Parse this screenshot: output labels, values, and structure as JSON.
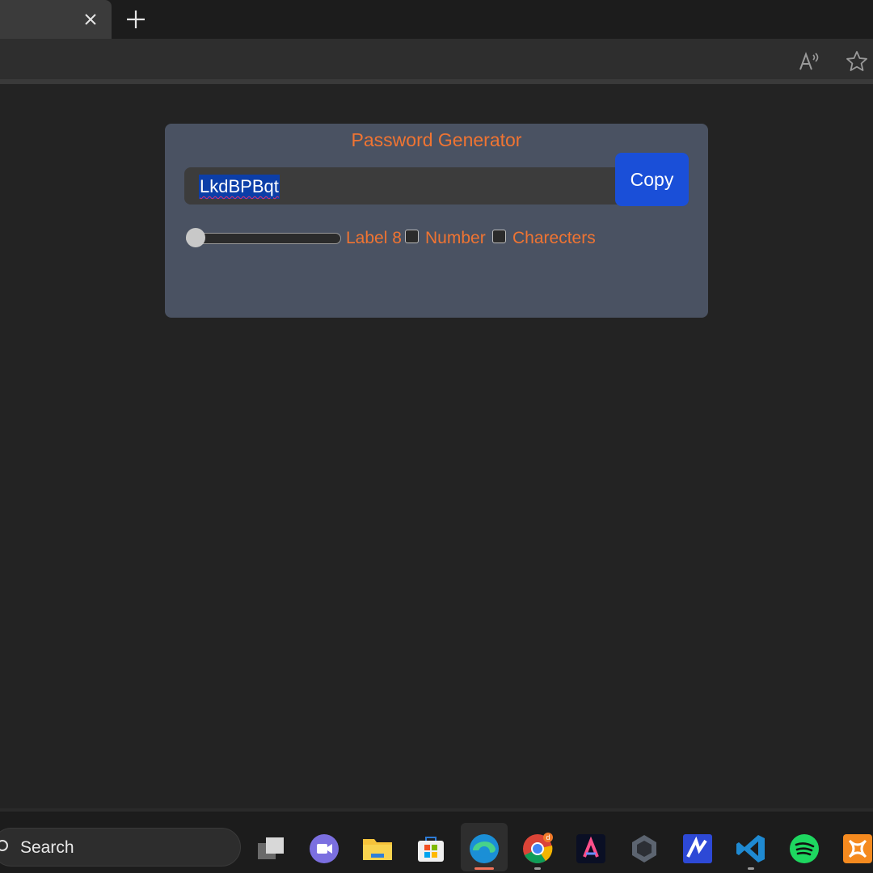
{
  "browser": {
    "close_tab_icon": "close-icon",
    "new_tab_icon": "plus-icon",
    "read_aloud_icon": "read-aloud-icon",
    "favorite_icon": "star-icon"
  },
  "card": {
    "title": "Password Generator",
    "password_value": "LkdBPBqt",
    "copy_label": "Copy",
    "length_label": "Label 8",
    "length_value": 8,
    "slider_fraction": 0.0,
    "number_label": "Number",
    "number_checked": false,
    "characters_label": "Charecters",
    "characters_checked": false
  },
  "colors": {
    "accent_orange": "#f07432",
    "copy_button": "#1a4fd8",
    "card_bg": "#4a5262"
  },
  "taskbar": {
    "search_label": "Search",
    "apps": [
      {
        "name": "task-view-icon"
      },
      {
        "name": "meet-icon"
      },
      {
        "name": "file-explorer-icon"
      },
      {
        "name": "microsoft-store-icon"
      },
      {
        "name": "edge-icon",
        "active": true
      },
      {
        "name": "chrome-icon",
        "badge": "d"
      },
      {
        "name": "adobe-express-icon"
      },
      {
        "name": "unity-icon"
      },
      {
        "name": "vector-app-icon"
      },
      {
        "name": "vscode-icon"
      },
      {
        "name": "spotify-icon"
      },
      {
        "name": "xampp-icon"
      }
    ]
  }
}
